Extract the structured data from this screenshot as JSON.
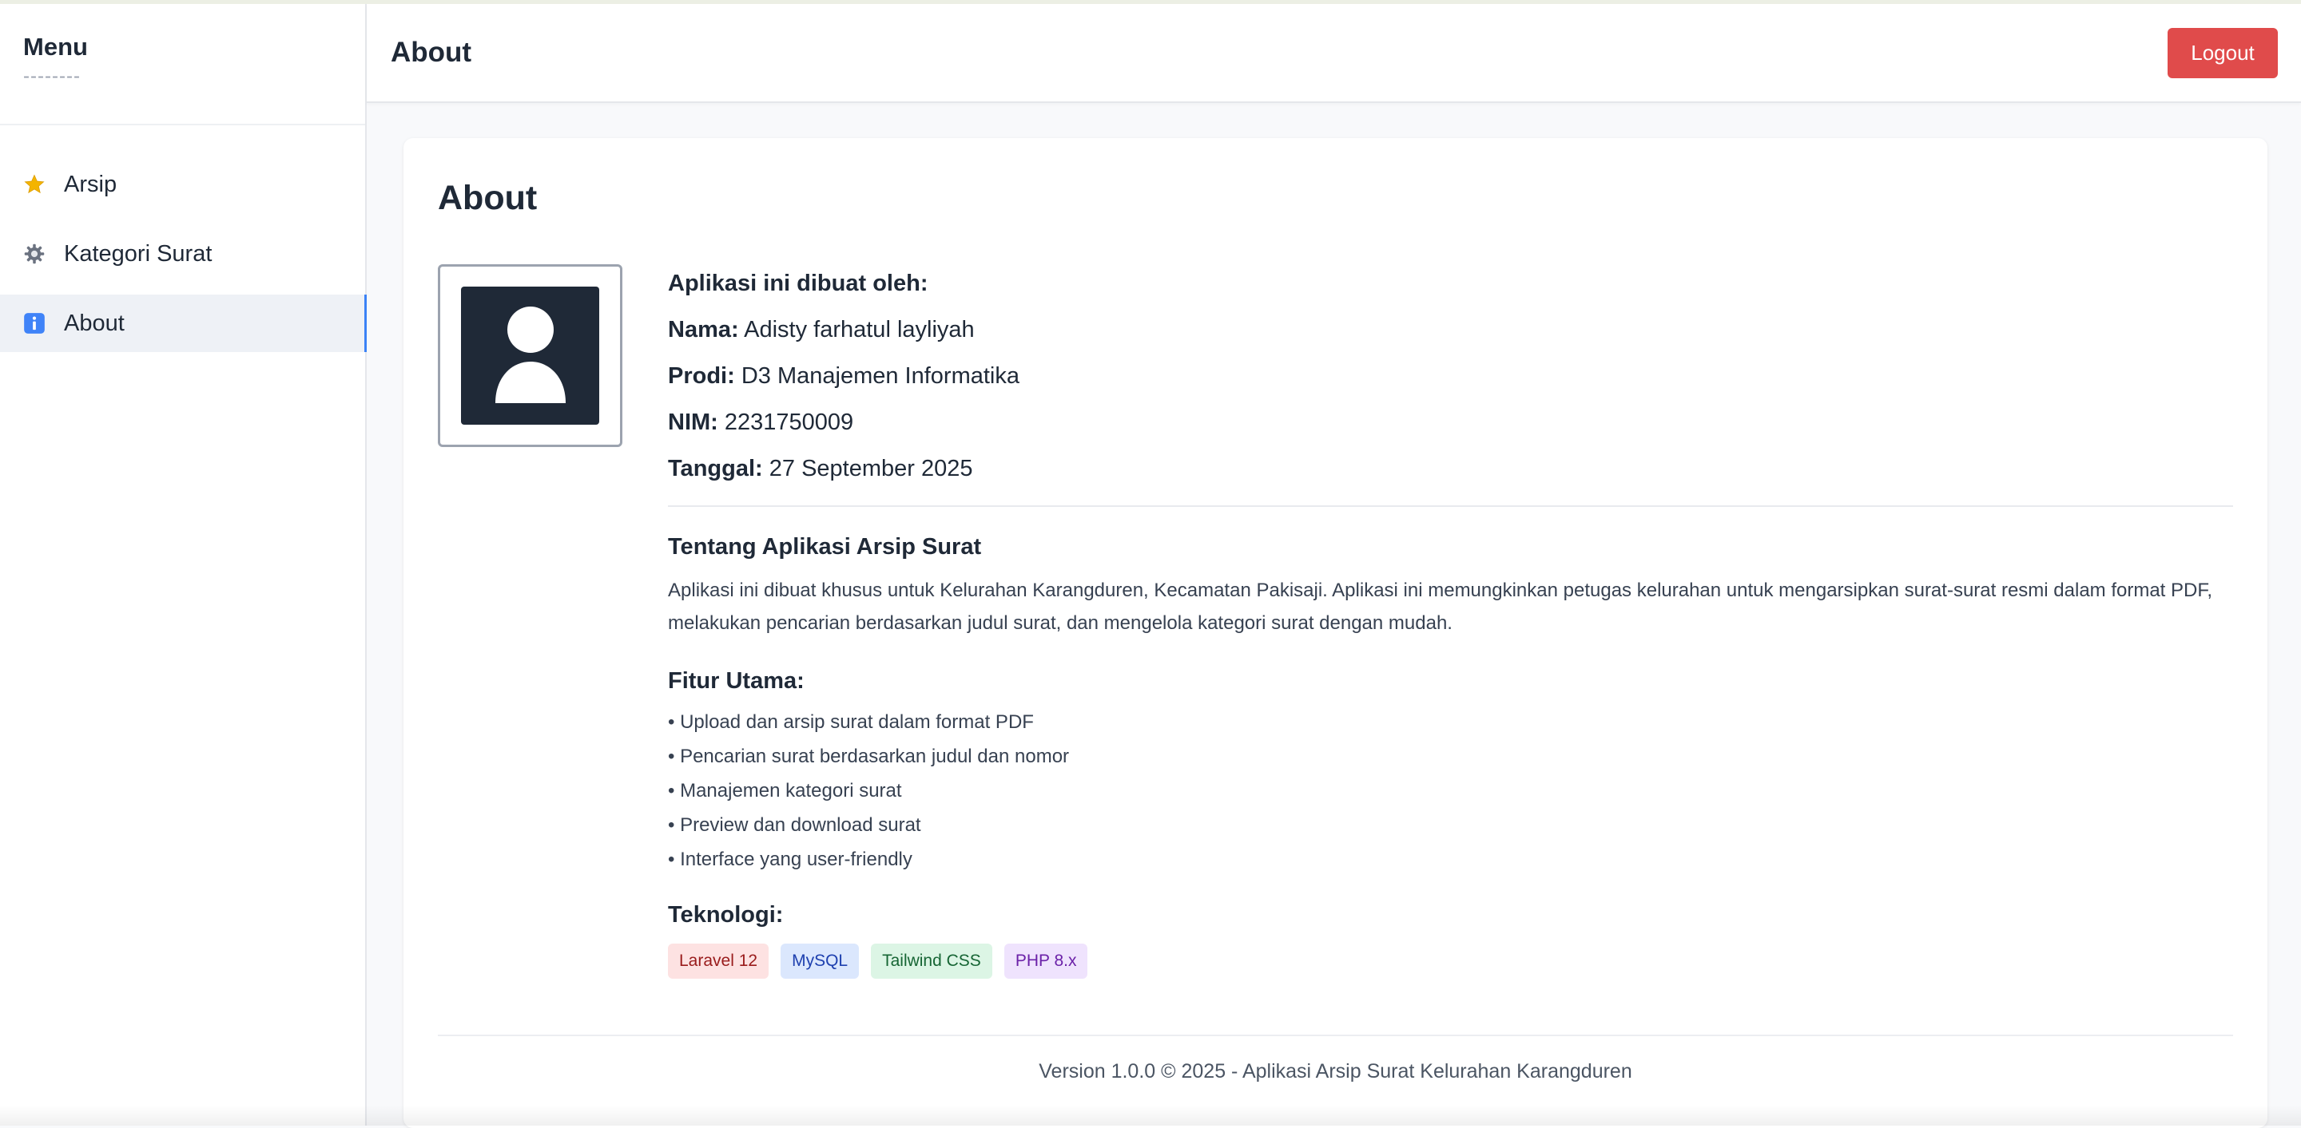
{
  "sidebar": {
    "title": "Menu",
    "subtitle": "--------",
    "items": [
      {
        "label": "Arsip",
        "icon": "star-icon"
      },
      {
        "label": "Kategori Surat",
        "icon": "gear-icon"
      },
      {
        "label": "About",
        "icon": "info-icon",
        "active": true
      }
    ]
  },
  "header": {
    "title": "About",
    "logout_label": "Logout"
  },
  "card": {
    "title": "About",
    "avatar_icon": "user-icon",
    "info": {
      "heading": "Aplikasi ini dibuat oleh:",
      "nama_label": "Nama:",
      "nama_value": "Adisty farhatul layliyah",
      "prodi_label": "Prodi:",
      "prodi_value": "D3 Manajemen Informatika",
      "nim_label": "NIM:",
      "nim_value": "2231750009",
      "tanggal_label": "Tanggal:",
      "tanggal_value": "27 September 2025"
    },
    "about_title": "Tentang Aplikasi Arsip Surat",
    "about_desc": "Aplikasi ini dibuat khusus untuk Kelurahan Karangduren, Kecamatan Pakisaji. Aplikasi ini memungkinkan petugas kelurahan untuk mengarsipkan surat-surat resmi dalam format PDF, melakukan pencarian berdasarkan judul surat, dan mengelola kategori surat dengan mudah.",
    "features_title": "Fitur Utama:",
    "features": [
      "• Upload dan arsip surat dalam format PDF",
      "• Pencarian surat berdasarkan judul dan nomor",
      "• Manajemen kategori surat",
      "• Preview dan download surat",
      "• Interface yang user-friendly"
    ],
    "tech_title": "Teknologi:",
    "tech": [
      "Laravel 12",
      "MySQL",
      "Tailwind CSS",
      "PHP 8.x"
    ],
    "footer": "Version 1.0.0 © 2025 - Aplikasi Arsip Surat Kelurahan Karangduren"
  },
  "colors": {
    "logout": "#e04b4b",
    "active_indicator": "#3b82f6",
    "avatar_bg": "#1f2937"
  }
}
